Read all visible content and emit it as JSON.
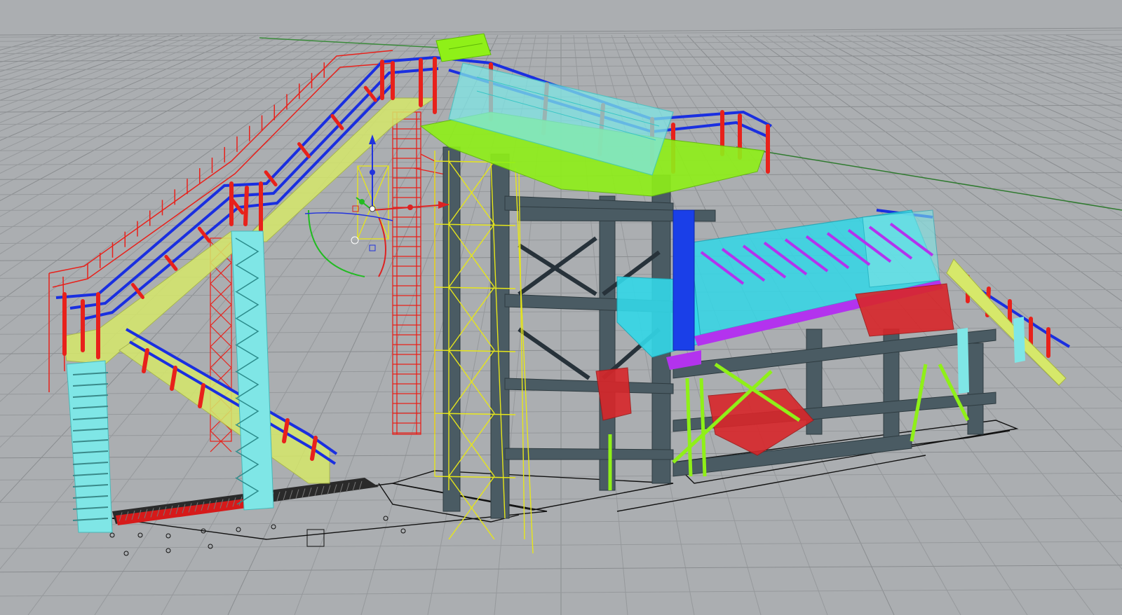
{
  "viewport": {
    "view": "Perspective",
    "background_color": "#abaeb1",
    "grid_color": "#96999c",
    "grid_major_color": "#8a8d90",
    "x_axis_color": "#3a8a3a",
    "y_axis_color": "#2f7a2f"
  },
  "model": {
    "stair_rail_color": "#e8211b",
    "handrail_color": "#1a2fe0",
    "tread_color": "#d6e86a",
    "column_color": "#7fe6e6",
    "hopper_frame_color": "#4a5b63",
    "bracing_color": "#e6e61a",
    "platform_color": "#8ff018",
    "conveyor_color": "#33d8e8",
    "screen_deck_color": "#b333ee",
    "chute_color": "#d8262a",
    "base_outline_color": "#111111"
  },
  "gizmo": {
    "icon": "gumball-manipulator-icon",
    "z_handle_color": "#2233dd",
    "x_handle_color": "#dd2222",
    "y_handle_color": "#22bb22"
  }
}
